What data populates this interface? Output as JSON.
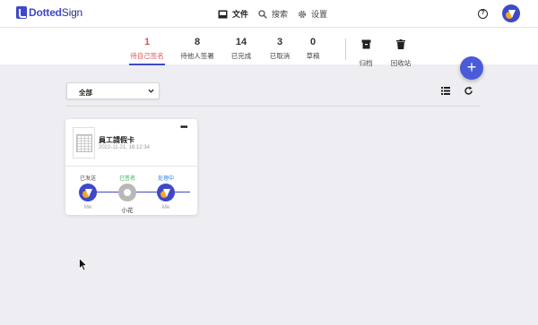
{
  "header": {
    "logo": {
      "brand_bold": "Dotted",
      "brand_rest": "Sign"
    },
    "nav": [
      {
        "label": "文件",
        "icon": "inbox-icon"
      },
      {
        "label": "搜索",
        "icon": "search-icon"
      },
      {
        "label": "设置",
        "icon": "gear-icon"
      }
    ],
    "help_icon_glyph": "?"
  },
  "stats": [
    {
      "count": "1",
      "label": "待自己签名",
      "active": true
    },
    {
      "count": "8",
      "label": "待他人签署",
      "active": false
    },
    {
      "count": "14",
      "label": "已完成",
      "active": false
    },
    {
      "count": "3",
      "label": "已取消",
      "active": false
    },
    {
      "count": "0",
      "label": "草稿",
      "active": false
    }
  ],
  "tools": [
    {
      "label": "归档",
      "icon": "archive-icon"
    },
    {
      "label": "回收站",
      "icon": "trash-icon"
    }
  ],
  "fab_label": "+",
  "filter": {
    "selected": "全部"
  },
  "card": {
    "title": "員工請假卡",
    "date": "2022-11-21, 16:12:34",
    "menu_glyph": "•••",
    "steps": [
      {
        "status": "已发送",
        "status_color": "#555555",
        "name": "Me"
      },
      {
        "status": "已签名",
        "status_color": "#27ae60",
        "name": "小花"
      },
      {
        "status": "处理中",
        "status_color": "#2f80ed",
        "name": "Me"
      }
    ]
  },
  "colors": {
    "accent": "#3f49c8",
    "active_tab": "#d9534f",
    "fab": "#4a5bd8"
  }
}
